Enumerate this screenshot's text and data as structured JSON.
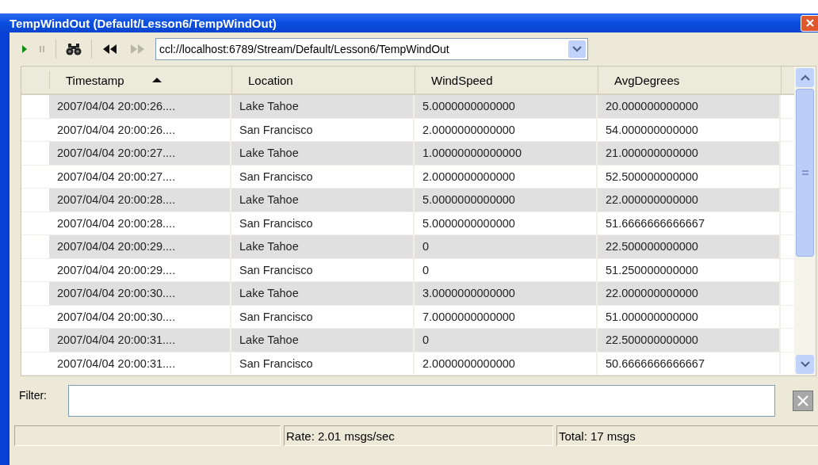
{
  "window": {
    "title": "TempWindOut (Default/Lesson6/TempWindOut)"
  },
  "toolbar": {
    "buttons": [
      {
        "kind": "play",
        "disabled": false
      },
      {
        "kind": "pause",
        "disabled": true
      },
      {
        "kind": "find",
        "disabled": false
      },
      {
        "kind": "rewind",
        "disabled": false
      },
      {
        "kind": "forward",
        "disabled": true
      }
    ],
    "stream_url": "ccl://localhost:6789/Stream/Default/Lesson6/TempWindOut"
  },
  "table": {
    "columns": [
      {
        "label": "Timestamp",
        "sorted": true
      },
      {
        "label": "Location",
        "sorted": false
      },
      {
        "label": "WindSpeed",
        "sorted": false
      },
      {
        "label": "AvgDegrees",
        "sorted": false
      }
    ],
    "rows": [
      [
        "2007/04/04 20:00:26....",
        "Lake Tahoe",
        "5.0000000000000",
        "20.000000000000"
      ],
      [
        "2007/04/04 20:00:26....",
        "San Francisco",
        "2.0000000000000",
        "54.000000000000"
      ],
      [
        "2007/04/04 20:00:27....",
        "Lake Tahoe",
        "1.00000000000000",
        "21.000000000000"
      ],
      [
        "2007/04/04 20:00:27....",
        "San Francisco",
        "2.0000000000000",
        "52.500000000000"
      ],
      [
        "2007/04/04 20:00:28....",
        "Lake Tahoe",
        "5.0000000000000",
        "22.000000000000"
      ],
      [
        "2007/04/04 20:00:28....",
        "San Francisco",
        "5.0000000000000",
        "51.6666666666667"
      ],
      [
        "2007/04/04 20:00:29....",
        "Lake Tahoe",
        "0",
        "22.500000000000"
      ],
      [
        "2007/04/04 20:00:29....",
        "San Francisco",
        "0",
        "51.250000000000"
      ],
      [
        "2007/04/04 20:00:30....",
        "Lake Tahoe",
        "3.0000000000000",
        "22.000000000000"
      ],
      [
        "2007/04/04 20:00:30....",
        "San Francisco",
        "7.0000000000000",
        "51.000000000000"
      ],
      [
        "2007/04/04 20:00:31....",
        "Lake Tahoe",
        "0",
        "22.500000000000"
      ],
      [
        "2007/04/04 20:00:31....",
        "San Francisco",
        "2.0000000000000",
        "50.6666666666667"
      ]
    ]
  },
  "filter": {
    "label": "Filter:"
  },
  "status_bar": [
    "Rate: 2.01 msgs/sec",
    "Total: 17 msgs"
  ]
}
